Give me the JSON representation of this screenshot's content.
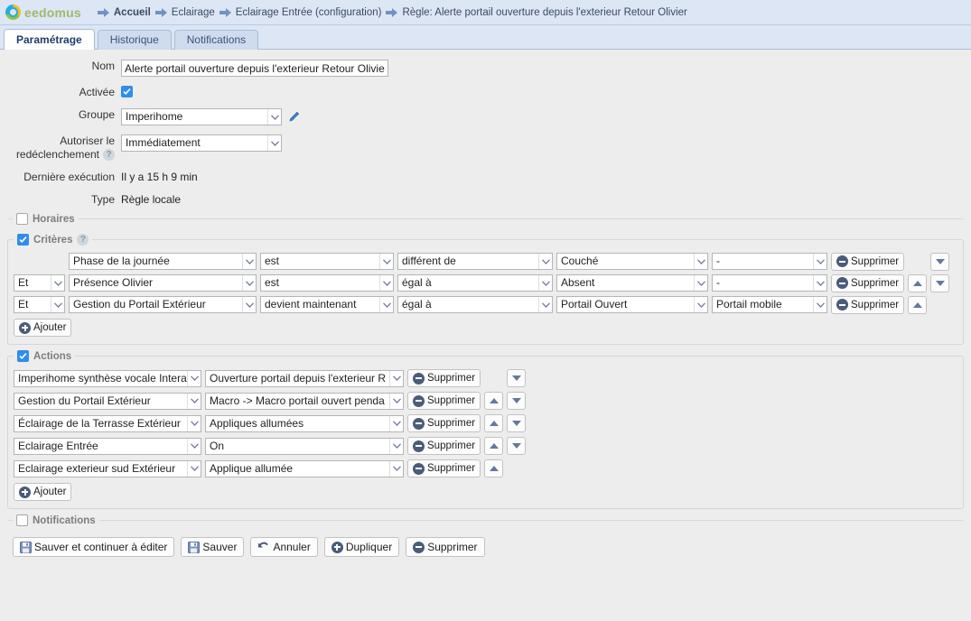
{
  "brand": {
    "name": "eedomus"
  },
  "breadcrumb": [
    {
      "label": "Accueil",
      "bold": true
    },
    {
      "label": "Eclairage",
      "bold": false
    },
    {
      "label": "Eclairage Entrée (configuration)",
      "bold": false
    },
    {
      "label": "Règle: Alerte portail ouverture depuis l'exterieur Retour Olivier",
      "bold": false
    }
  ],
  "tabs": [
    {
      "label": "Paramétrage",
      "active": true
    },
    {
      "label": "Historique",
      "active": false
    },
    {
      "label": "Notifications",
      "active": false
    }
  ],
  "form": {
    "nom_label": "Nom",
    "nom_value": "Alerte portail ouverture depuis l'exterieur Retour Olivier",
    "activee_label": "Activée",
    "activee_checked": true,
    "groupe_label": "Groupe",
    "groupe_value": "Imperihome",
    "autoriser_label_line1": "Autoriser le",
    "autoriser_label_line2": "redéclenchement",
    "autoriser_value": "Immédiatement",
    "help_glyph": "?",
    "derniere_label": "Dernière exécution",
    "derniere_value": "Il y a 15 h 9 min",
    "type_label": "Type",
    "type_value": "Règle locale"
  },
  "sections": {
    "horaires": {
      "legend": "Horaires",
      "checked": false
    },
    "criteres": {
      "legend": "Critères",
      "checked": true,
      "has_help": true
    },
    "actions": {
      "legend": "Actions",
      "checked": true
    },
    "notifications": {
      "legend": "Notifications",
      "checked": false
    }
  },
  "criteria": {
    "delete_label": "Supprimer",
    "add_label": "Ajouter",
    "rows": [
      {
        "conj": "",
        "subject": "Phase de la journée",
        "verb": "est",
        "operator": "différent de",
        "value": "Couché",
        "extra": "-",
        "up": false,
        "down": true
      },
      {
        "conj": "Et",
        "subject": "Présence Olivier",
        "verb": "est",
        "operator": "égal à",
        "value": "Absent",
        "extra": "-",
        "up": true,
        "down": true
      },
      {
        "conj": "Et",
        "subject": "Gestion du Portail Extérieur",
        "verb": "devient maintenant",
        "operator": "égal à",
        "value": "Portail Ouvert",
        "extra": "Portail mobile",
        "up": true,
        "down": false
      }
    ]
  },
  "actions": {
    "delete_label": "Supprimer",
    "add_label": "Ajouter",
    "rows": [
      {
        "target": "Imperihome synthèse vocale Intera",
        "command": "Ouverture portail depuis l'exterieur R",
        "up": false,
        "down": true
      },
      {
        "target": "Gestion du Portail Extérieur",
        "command": "Macro -> Macro portail ouvert penda",
        "up": true,
        "down": true
      },
      {
        "target": "Éclairage de la Terrasse Extérieur",
        "command": "Appliques allumées",
        "up": true,
        "down": true
      },
      {
        "target": "Eclairage Entrée",
        "command": "On",
        "up": true,
        "down": true
      },
      {
        "target": "Eclairage exterieur sud Extérieur",
        "command": "Applique allumée",
        "up": true,
        "down": false
      }
    ]
  },
  "footer": {
    "buttons": [
      {
        "label": "Sauver et continuer à éditer",
        "icon": "save-icon"
      },
      {
        "label": "Sauver",
        "icon": "save-icon"
      },
      {
        "label": "Annuler",
        "icon": "undo-icon"
      },
      {
        "label": "Dupliquer",
        "icon": "duplicate-icon"
      },
      {
        "label": "Supprimer",
        "icon": "delete-icon"
      }
    ]
  },
  "colors": {
    "header_bg": "#dce6f4",
    "accent_blue": "#2f8ded",
    "icon_navy": "#4a5c7a",
    "page_bg": "#ededed"
  }
}
